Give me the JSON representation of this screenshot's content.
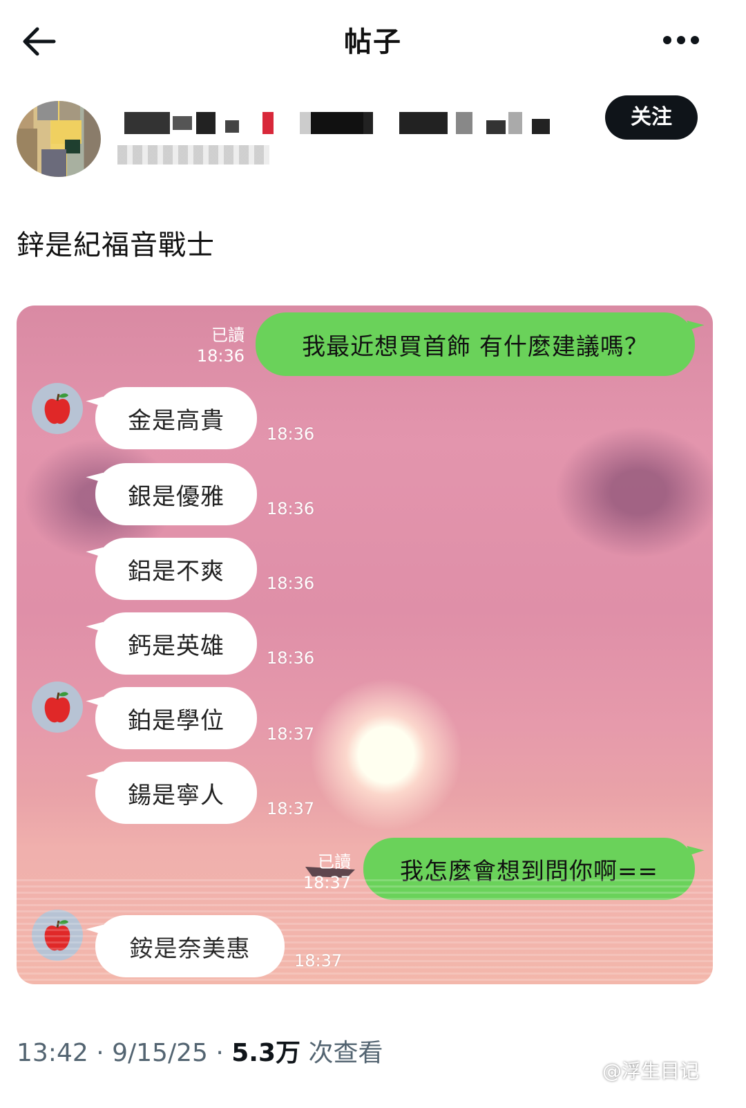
{
  "header": {
    "title": "帖子",
    "back_icon": "arrow-left-icon",
    "more_icon": "more-horizontal-icon"
  },
  "author": {
    "follow_label": "关注"
  },
  "post": {
    "text": "鋅是紀福音戰士"
  },
  "chat": {
    "messages": [
      {
        "side": "out",
        "text": "我最近想買首飾 有什麼建議嗎？",
        "read": "已讀",
        "time": "18:36"
      },
      {
        "side": "in",
        "text": "金是高貴",
        "time": "18:36"
      },
      {
        "side": "in",
        "text": "銀是優雅",
        "time": "18:36"
      },
      {
        "side": "in",
        "text": "鋁是不爽",
        "time": "18:36"
      },
      {
        "side": "in",
        "text": "鈣是英雄",
        "time": "18:36"
      },
      {
        "side": "in",
        "text": "鉑是學位",
        "time": "18:37"
      },
      {
        "side": "in",
        "text": "鍚是寧人",
        "time": "18:37"
      },
      {
        "side": "out",
        "text": "我怎麼會想到問你啊==",
        "read": "已讀",
        "time": "18:37"
      },
      {
        "side": "in",
        "text": "銨是奈美惠",
        "time": "18:37"
      }
    ],
    "contact_icon": "apple-icon"
  },
  "footer": {
    "time": "13:42",
    "date": "9/15/25",
    "views": "5.3万",
    "views_label": "次查看",
    "sep": "·"
  },
  "watermark": "@浮生目记"
}
